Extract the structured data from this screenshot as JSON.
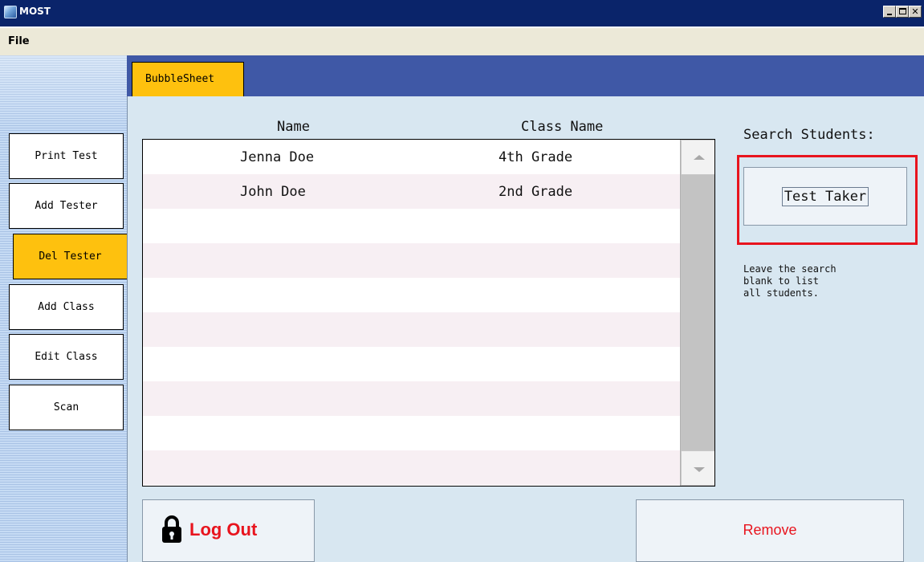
{
  "window": {
    "title": "MOST",
    "icon": "app-icon"
  },
  "menu": {
    "file": "File"
  },
  "sidebar": {
    "items": [
      {
        "label": "Print Test",
        "active": false
      },
      {
        "label": "Add Tester",
        "active": false
      },
      {
        "label": "Del Tester",
        "active": true
      },
      {
        "label": "Add Class",
        "active": false
      },
      {
        "label": "Edit Class",
        "active": false
      },
      {
        "label": "Scan",
        "active": false
      }
    ]
  },
  "tabs": [
    {
      "label": "BubbleSheet",
      "active": true
    }
  ],
  "table": {
    "columns": [
      "Name",
      "Class Name"
    ],
    "rows": [
      {
        "name": "Jenna Doe",
        "class_name": "4th Grade"
      },
      {
        "name": "John Doe",
        "class_name": "2nd Grade"
      }
    ]
  },
  "search": {
    "label": "Search Students:",
    "value": "Test Taker",
    "hint_lines": [
      "Leave the search",
      "blank to list",
      "all students."
    ]
  },
  "buttons": {
    "logout": "Log Out",
    "logout_icon": "lock-icon",
    "remove": "Remove"
  },
  "colors": {
    "accent_yellow": "#fec10e",
    "tab_bar_blue": "#3f58a6",
    "highlight_red": "#e8141e",
    "titlebar_navy": "#0a246a"
  }
}
